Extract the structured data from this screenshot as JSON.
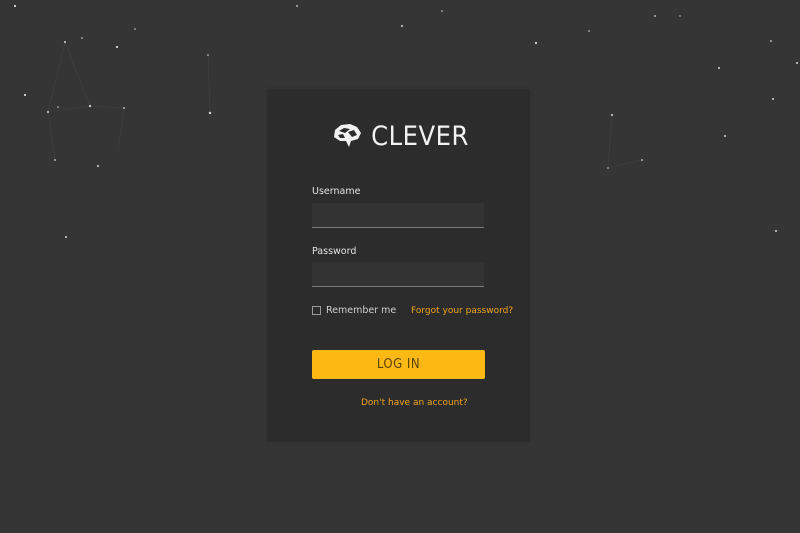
{
  "brand": {
    "name": "CLEVER",
    "icon": "brain-icon"
  },
  "form": {
    "username_label": "Username",
    "username_value": "",
    "password_label": "Password",
    "password_value": "",
    "remember_label": "Remember me",
    "remember_checked": false,
    "forgot_link": "Forgot your password?",
    "login_button": "LOG IN",
    "signup_link": "Don't have an account?"
  },
  "colors": {
    "background": "#353535",
    "card": "#2c2c2c",
    "accent": "#fdb813",
    "link": "#f2a51a"
  }
}
